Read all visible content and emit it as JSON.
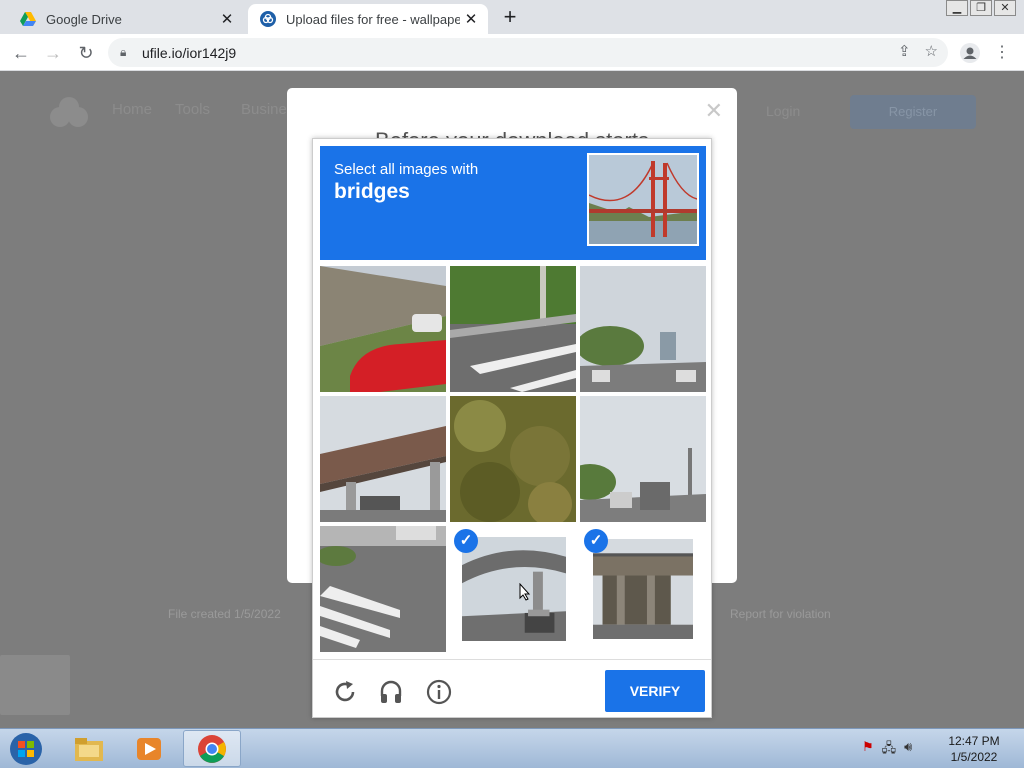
{
  "browser": {
    "tabs": [
      {
        "title": "Google Drive",
        "active": false
      },
      {
        "title": "Upload files for free - wallpaper",
        "active": true
      }
    ],
    "url": "ufile.io/ior142j9"
  },
  "background_page": {
    "nav": [
      "Home",
      "Tools",
      "Business"
    ],
    "login": "Login",
    "register": "Register",
    "modal_title": "Before your download starts",
    "file_created": "File created 1/5/2022",
    "report": "Report for violation"
  },
  "captcha": {
    "instruction": "Select all images with",
    "target": "bridges",
    "verify_label": "VERIFY",
    "tiles": [
      {
        "scene": "building-red-car",
        "selected": false
      },
      {
        "scene": "crosswalk-grass",
        "selected": false
      },
      {
        "scene": "city-road-trees",
        "selected": false
      },
      {
        "scene": "overpass-trucks",
        "selected": false
      },
      {
        "scene": "vegetation",
        "selected": false
      },
      {
        "scene": "road-sign-truck",
        "selected": false
      },
      {
        "scene": "crosswalk-lot",
        "selected": false
      },
      {
        "scene": "overpass-truck",
        "selected": true
      },
      {
        "scene": "overpass-side",
        "selected": true
      }
    ],
    "icons": [
      "reload-icon",
      "audio-icon",
      "info-icon"
    ]
  },
  "taskbar": {
    "time": "12:47 PM",
    "date": "1/5/2022"
  }
}
